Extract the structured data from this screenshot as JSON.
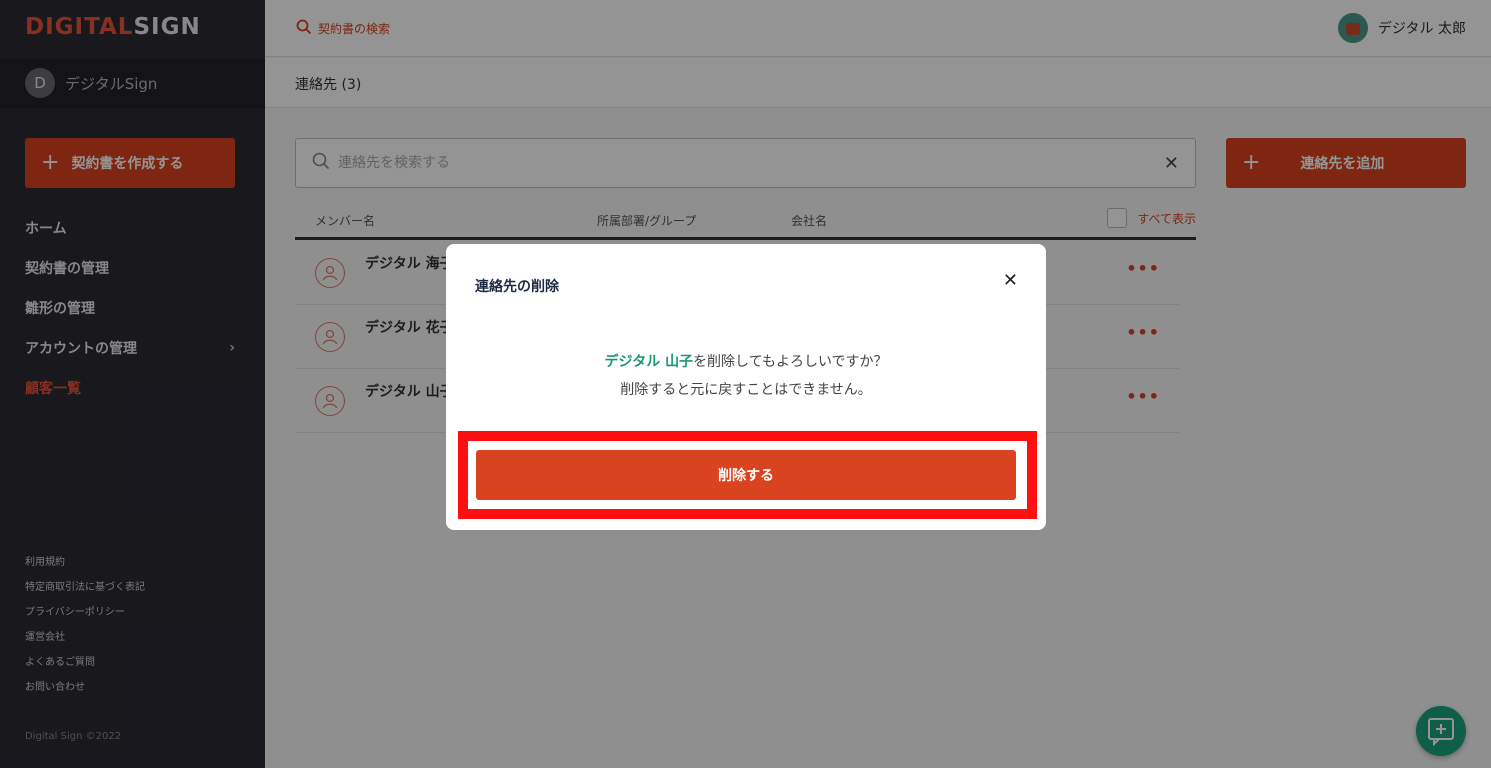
{
  "brand": {
    "logo_part1": "DIGITAL",
    "logo_part2": "SIGN"
  },
  "org": {
    "avatar_letter": "D",
    "name": "デジタルSign"
  },
  "sidebar": {
    "create_label": "契約書を作成する",
    "items": [
      {
        "label": "ホーム"
      },
      {
        "label": "契約書の管理"
      },
      {
        "label": "雛形の管理"
      },
      {
        "label": "アカウントの管理"
      },
      {
        "label": "顧客一覧"
      }
    ],
    "footer_links": [
      "利用規約",
      "特定商取引法に基づく表記",
      "プライバシーポリシー",
      "運営会社",
      "よくあるご質問",
      "お問い合わせ"
    ],
    "copyright": "Digital Sign ©2022"
  },
  "topbar": {
    "search_label": "契約書の検索",
    "user_name": "デジタル 太郎"
  },
  "page": {
    "title": "連絡先 (3)"
  },
  "contacts": {
    "search_placeholder": "連絡先を検索する",
    "add_label": "連絡先を追加",
    "columns": [
      "メンバー名",
      "所属部署/グループ",
      "会社名"
    ],
    "show_all_label": "すべて表示",
    "rows": [
      {
        "name": "デジタル 海子"
      },
      {
        "name": "デジタル 花子"
      },
      {
        "name": "デジタル 山子"
      }
    ],
    "more_glyph": "•••"
  },
  "modal": {
    "title": "連絡先の削除",
    "target_name": "デジタル 山子",
    "message_suffix": "を削除してもよろしいですか？",
    "message_line2": "削除すると元に戻すことはできません。",
    "delete_label": "削除する"
  },
  "colors": {
    "accent": "#d9431f",
    "sidebar_bg": "#2b2a33",
    "highlight": "#1a9a6c",
    "focus_ring": "#ff1010"
  }
}
